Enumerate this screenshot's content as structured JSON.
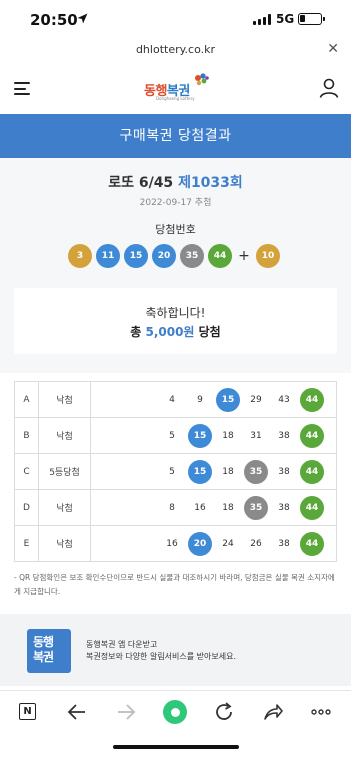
{
  "status_bar": {
    "time": "20:50",
    "network": "5G",
    "battery_level": 0.2
  },
  "browser": {
    "url": "dhlottery.co.kr"
  },
  "header": {
    "logo_text_1": "동행",
    "logo_text_2": "복권",
    "logo_sub": "Donghaeng Lottery"
  },
  "page_title": "구매복권 당첨결과",
  "draw": {
    "game": "로또 6/45",
    "round": "제1033회",
    "date": "2022-09-17 추첨",
    "numbers_label": "당첨번호",
    "winning_numbers": [
      "3",
      "11",
      "15",
      "20",
      "35",
      "44"
    ],
    "winning_colors": [
      "yellow",
      "blue",
      "blue",
      "blue",
      "gray",
      "green"
    ],
    "bonus_symbol": "+",
    "bonus_number": "10",
    "bonus_color": "yellow"
  },
  "congrats": {
    "line1": "축하합니다!",
    "prefix": "총 ",
    "amount": "5,000원",
    "suffix": " 당첨"
  },
  "tickets": [
    {
      "label": "A",
      "result": "낙첨",
      "numbers": [
        "4",
        "9",
        "15",
        "29",
        "43",
        "44"
      ],
      "hits": [
        null,
        null,
        "blue",
        null,
        null,
        "green"
      ]
    },
    {
      "label": "B",
      "result": "낙첨",
      "numbers": [
        "5",
        "15",
        "18",
        "31",
        "38",
        "44"
      ],
      "hits": [
        null,
        "blue",
        null,
        null,
        null,
        "green"
      ]
    },
    {
      "label": "C",
      "result": "5등당첨",
      "numbers": [
        "5",
        "15",
        "18",
        "35",
        "38",
        "44"
      ],
      "hits": [
        null,
        "blue",
        null,
        "gray",
        null,
        "green"
      ]
    },
    {
      "label": "D",
      "result": "낙첨",
      "numbers": [
        "8",
        "16",
        "18",
        "35",
        "38",
        "44"
      ],
      "hits": [
        null,
        null,
        null,
        "gray",
        null,
        "green"
      ]
    },
    {
      "label": "E",
      "result": "낙첨",
      "numbers": [
        "16",
        "20",
        "24",
        "26",
        "38",
        "44"
      ],
      "hits": [
        null,
        "blue",
        null,
        null,
        null,
        "green"
      ]
    }
  ],
  "notice": "- QR 당첨확인은 보조 확인수단이므로 반드시 실물과 대조하시기 바라며, 당첨금은 실물 복권 소지자에게 지급합니다.",
  "app_banner": {
    "icon_line1": "동행",
    "icon_line2": "복권",
    "line1": "동행복권 앱 다운받고",
    "line2": "복권정보와 다양한 알림서비스를 받아보세요."
  },
  "toolbar": {
    "n_label": "N"
  },
  "colors": {
    "accent": "#3f7ecb",
    "yellow": "#d4a23a",
    "blue": "#3f8ad6",
    "gray": "#8a8a8a",
    "green": "#5aa83a"
  }
}
